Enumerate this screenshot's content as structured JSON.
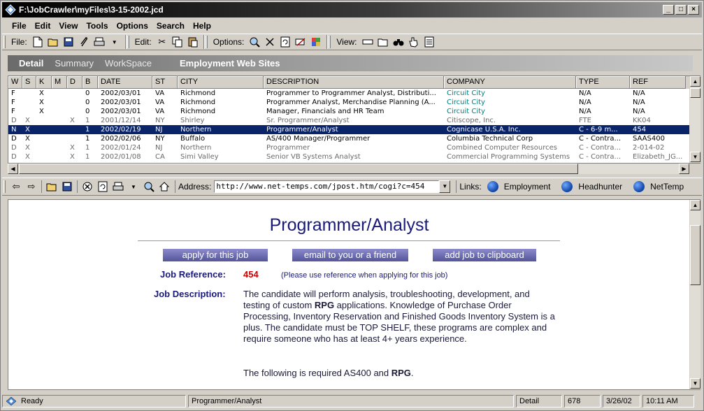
{
  "window": {
    "title": "F:\\JobCrawler\\myFiles\\3-15-2002.jcd"
  },
  "menu": [
    "File",
    "Edit",
    "View",
    "Tools",
    "Options",
    "Search",
    "Help"
  ],
  "toolbar": {
    "file_label": "File:",
    "edit_label": "Edit:",
    "options_label": "Options:",
    "view_label": "View:"
  },
  "tabs": {
    "detail": "Detail",
    "summary": "Summary",
    "workspace": "WorkSpace",
    "section_title": "Employment Web Sites"
  },
  "grid": {
    "columns": [
      "W",
      "S",
      "K",
      "M",
      "D",
      "B",
      "DATE",
      "ST",
      "CITY",
      "DESCRIPTION",
      "COMPANY",
      "TYPE",
      "REF"
    ],
    "rows": [
      {
        "w": "F",
        "s": "",
        "k": "X",
        "m": "",
        "d": "",
        "b": "0",
        "date": "2002/03/01",
        "st": "VA",
        "city": "Richmond",
        "desc": "Programmer to Programmer Analyst, Distributi...",
        "company": "Circuit City",
        "type": "N/A",
        "ref": "N/A",
        "style": "normal",
        "company_link": true
      },
      {
        "w": "F",
        "s": "",
        "k": "X",
        "m": "",
        "d": "",
        "b": "0",
        "date": "2002/03/01",
        "st": "VA",
        "city": "Richmond",
        "desc": "Programmer Analyst, Merchandise Planning (A...",
        "company": "Circuit City",
        "type": "N/A",
        "ref": "N/A",
        "style": "normal",
        "company_link": true
      },
      {
        "w": "F",
        "s": "",
        "k": "X",
        "m": "",
        "d": "",
        "b": "0",
        "date": "2002/03/01",
        "st": "VA",
        "city": "Richmond",
        "desc": "Manager, Financials and HR Team",
        "company": "Circuit City",
        "type": "N/A",
        "ref": "N/A",
        "style": "normal",
        "company_link": true
      },
      {
        "w": "D",
        "s": "X",
        "k": "",
        "m": "",
        "d": "X",
        "b": "1",
        "date": "2001/12/14",
        "st": "NY",
        "city": "Shirley",
        "desc": "Sr. Programmer/Analyst",
        "company": "Citiscope, Inc.",
        "type": "FTE",
        "ref": "KK04",
        "style": "gray",
        "company_link": false
      },
      {
        "w": "N",
        "s": "X",
        "k": "",
        "m": "",
        "d": "",
        "b": "1",
        "date": "2002/02/19",
        "st": "NJ",
        "city": "Northern",
        "desc": "Programmer/Analyst",
        "company": "Cognicase U.S.A. Inc.",
        "type": "C - 6-9 m...",
        "ref": "454",
        "style": "selected",
        "company_link": false
      },
      {
        "w": "D",
        "s": "X",
        "k": "",
        "m": "",
        "d": "",
        "b": "1",
        "date": "2002/02/06",
        "st": "NY",
        "city": "Buffalo",
        "desc": "AS/400 Manager/Programmer",
        "company": "Columbia Technical Corp",
        "type": "C - Contra...",
        "ref": "SAAS400",
        "style": "normal",
        "company_link": false
      },
      {
        "w": "D",
        "s": "X",
        "k": "",
        "m": "",
        "d": "X",
        "b": "1",
        "date": "2002/01/24",
        "st": "NJ",
        "city": "Northern",
        "desc": "Programmer",
        "company": "Combined Computer Resources",
        "type": "C - Contra...",
        "ref": "2-014-02",
        "style": "gray",
        "company_link": false
      },
      {
        "w": "D",
        "s": "X",
        "k": "",
        "m": "",
        "d": "X",
        "b": "1",
        "date": "2002/01/08",
        "st": "CA",
        "city": "Simi Valley",
        "desc": "Senior VB Systems Analyst",
        "company": "Commercial Programming Systems",
        "type": "C - Contra...",
        "ref": "Elizabeth_JG...",
        "style": "gray",
        "company_link": false
      }
    ]
  },
  "nav": {
    "address_label": "Address:",
    "address_value": "http://www.net-temps.com/jpost.htm/cogi?c=454",
    "links_label": "Links:",
    "links": [
      "Employment",
      "Headhunter",
      "NetTemp"
    ]
  },
  "page": {
    "title": "Programmer/Analyst",
    "buttons": [
      "apply for this job",
      "email to you or a friend",
      "add job to clipboard"
    ],
    "ref_label": "Job Reference:",
    "ref_value": "454",
    "ref_note": "(Please use reference when applying for this job)",
    "desc_label": "Job Description:",
    "desc_parts": [
      "The candidate will perform analysis, troubleshooting, development, and testing of custom ",
      "RPG",
      " applications. Knowledge of Purchase Order Processing, Inventory Reservation and Finished Goods Inventory System is a plus. The candidate must be TOP SHELF, these programs are complex and require someone who has at least 4+ years experience."
    ],
    "req_parts": [
      "The following is required AS400 and ",
      "RPG",
      "."
    ]
  },
  "status": {
    "ready": "Ready",
    "title": "Programmer/Analyst",
    "view": "Detail",
    "count": "678",
    "date": "3/26/02",
    "time": "10:11 AM"
  }
}
